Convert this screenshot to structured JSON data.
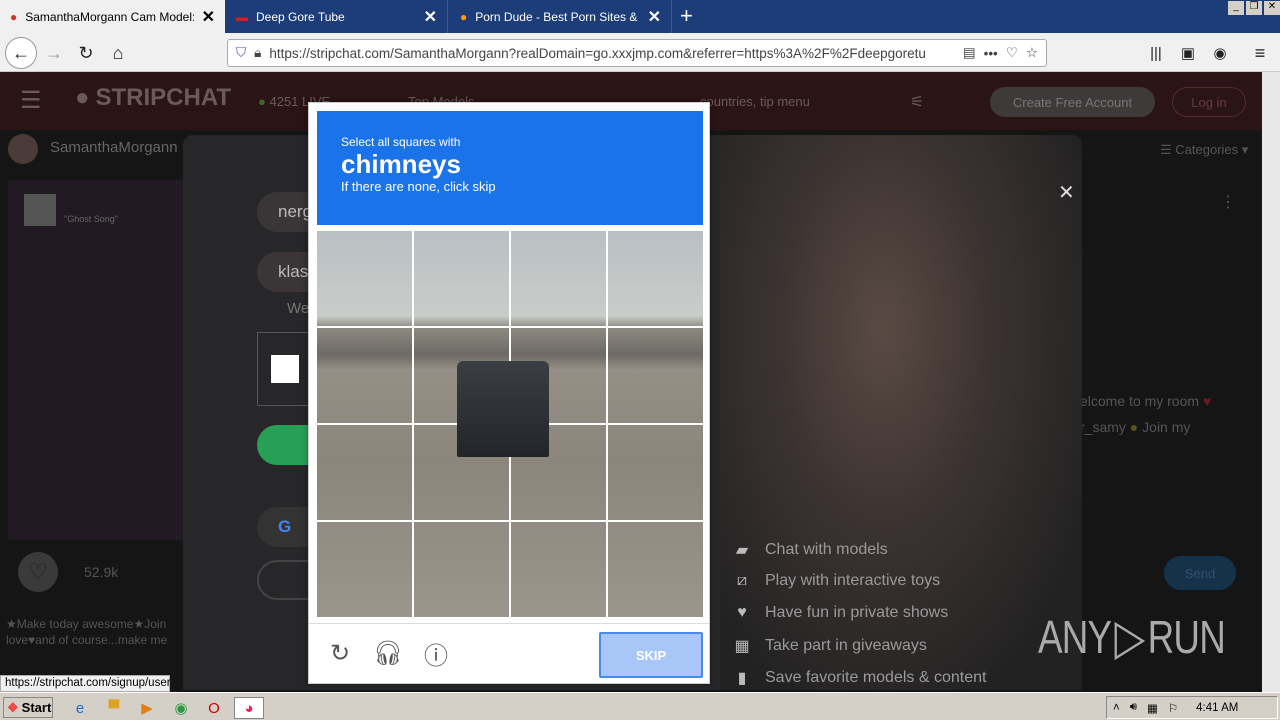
{
  "browser": {
    "tabs": [
      {
        "title": "SamanthaMorgann Cam Model: Free",
        "active": true
      },
      {
        "title": "Deep Gore Tube",
        "active": false
      },
      {
        "title": "Porn Dude - Best Porn Sites & Free",
        "active": false
      }
    ],
    "url": "https://stripchat.com/SamanthaMorgann?realDomain=go.xxxjmp.com&referrer=https%3A%2F%2Fdeepgoretu",
    "status_url": "https://stripchat.com/signup/user"
  },
  "site": {
    "logo": "STRIPCHAT",
    "live_count": "4251",
    "live_label": "LIVE",
    "top_models": "Top Models",
    "search_placeholder": "countries, tip menu",
    "create_account": "Create Free Account",
    "login": "Log in",
    "model_name": "SamanthaMorgann",
    "categories": "Categories",
    "song": "\"Ghost Song\"",
    "likes": "52.9k",
    "bio_line1": "★Make today awesome★Join",
    "bio_line2": "love♥and of course...make me",
    "chat_line1": "elcome to my room",
    "chat_line2": "r_samy",
    "chat_line2b": "Join my",
    "send": "Send"
  },
  "signup": {
    "username_value": "nerg",
    "password_value": "klas",
    "note": "We",
    "features": [
      {
        "icon": "chat-icon",
        "text": "Chat with models"
      },
      {
        "icon": "toy-icon",
        "text": "Play with interactive toys"
      },
      {
        "icon": "heart-icon",
        "text": "Have fun in private shows"
      },
      {
        "icon": "gift-icon",
        "text": "Take part in giveaways"
      },
      {
        "icon": "bookmark-icon",
        "text": "Save favorite models & content"
      }
    ]
  },
  "captcha": {
    "instruction": "Select all squares with",
    "target": "chimneys",
    "hint": "If there are none, click skip",
    "skip": "SKIP",
    "accent": "#1a73e8"
  },
  "taskbar": {
    "start": "Start",
    "time": "4:41 AM"
  },
  "watermark": "ANY RUN"
}
